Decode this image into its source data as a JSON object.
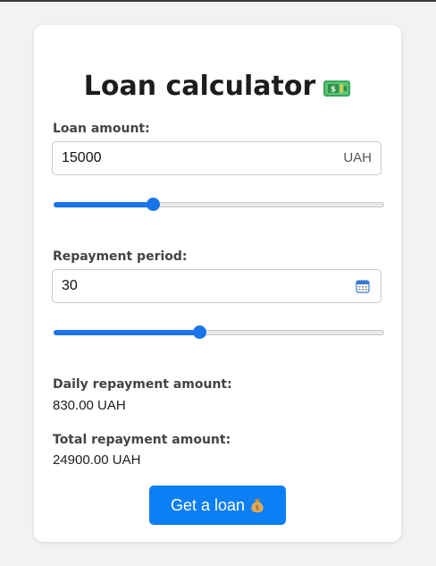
{
  "title": "Loan calculator",
  "title_icon": "money-icon",
  "loan_amount": {
    "label": "Loan amount:",
    "value": "15000",
    "unit": "UAH",
    "slider_fraction": 0.3
  },
  "repayment_period": {
    "label": "Repayment period:",
    "value": "30",
    "icon": "calendar-icon",
    "slider_fraction": 0.44
  },
  "daily_repayment": {
    "label": "Daily repayment amount:",
    "value": "830.00 UAH"
  },
  "total_repayment": {
    "label": "Total repayment amount:",
    "value": "24900.00 UAH"
  },
  "cta": {
    "label": "Get a loan",
    "icon": "money-bag-icon"
  },
  "colors": {
    "accent": "#0d7ff5",
    "slider": "#1a75e8"
  }
}
